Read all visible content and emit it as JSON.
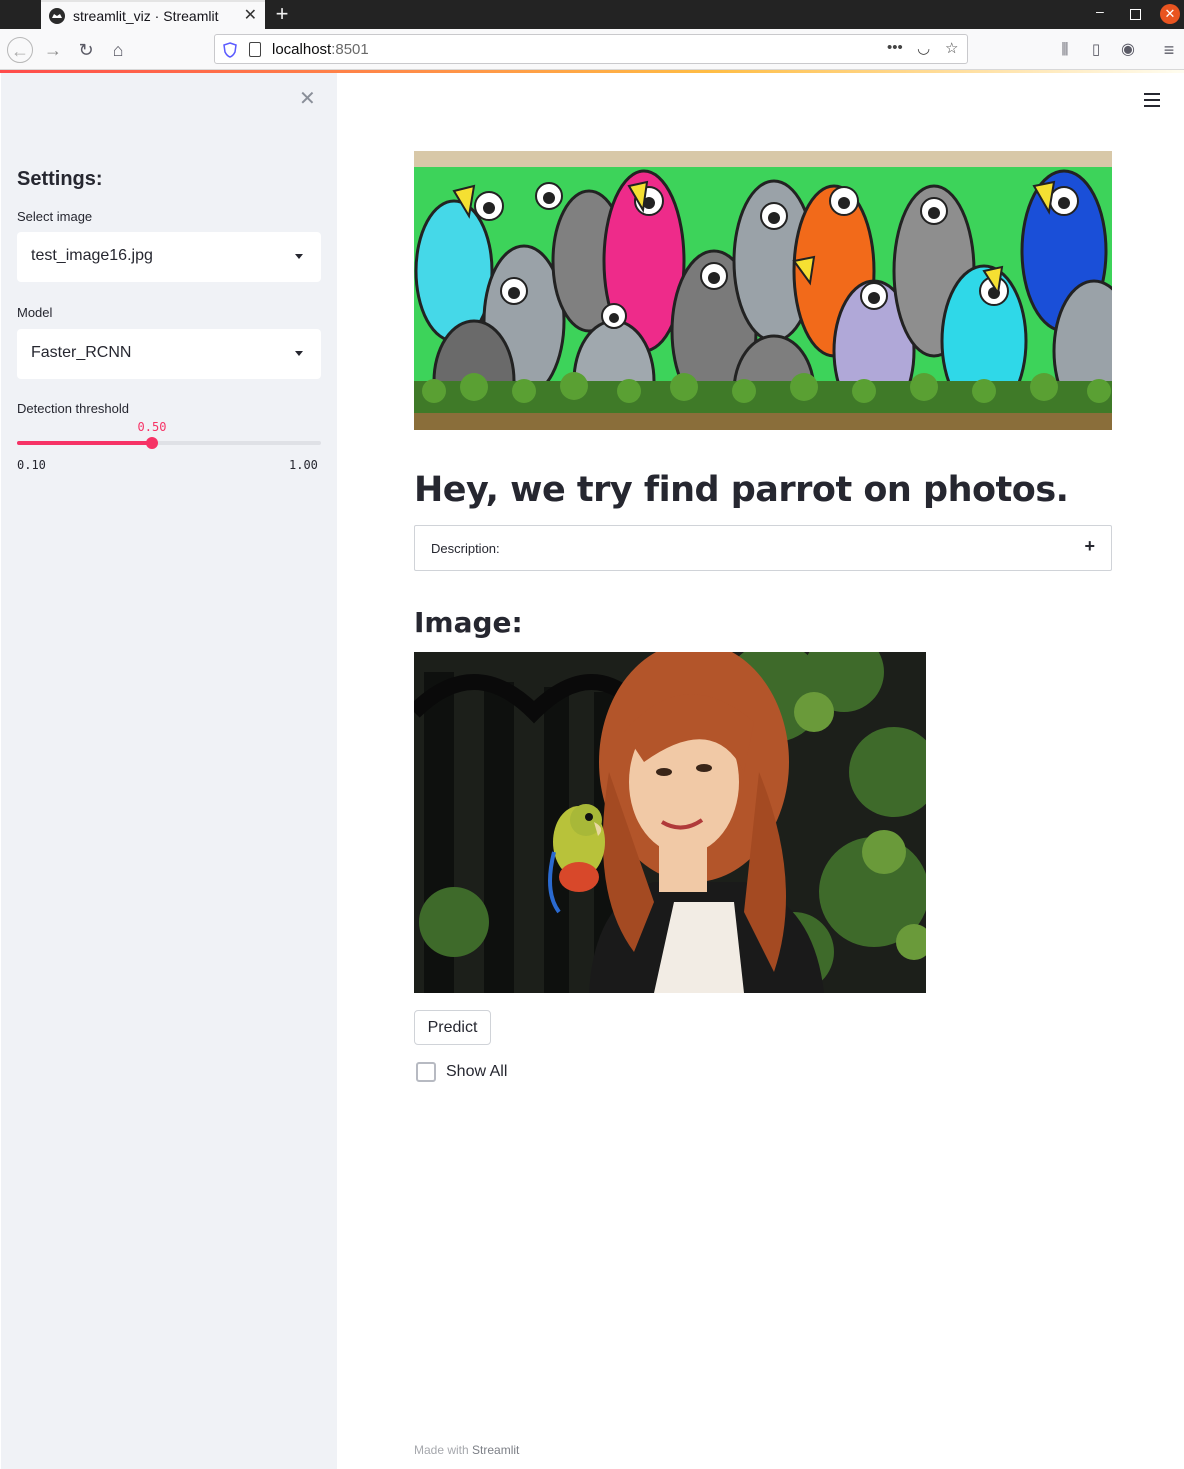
{
  "browser": {
    "tab_title": "streamlit_viz · Streamlit",
    "url_host": "localhost",
    "url_port": ":8501"
  },
  "sidebar": {
    "heading": "Settings:",
    "select_image": {
      "label": "Select image",
      "value": "test_image16.jpg"
    },
    "model": {
      "label": "Model",
      "value": "Faster_RCNN"
    },
    "threshold": {
      "label": "Detection threshold",
      "value": "0.50",
      "min": "0.10",
      "max": "1.00",
      "fraction": 0.444
    }
  },
  "main": {
    "title": "Hey, we try find parrot on photos.",
    "expander_label": "Description:",
    "image_heading": "Image:",
    "predict_label": "Predict",
    "show_all_label": "Show All",
    "footer_prefix": "Made with ",
    "footer_brand": "Streamlit"
  },
  "colors": {
    "accent": "#f63366",
    "sidebar_bg": "#f0f2f6",
    "text": "#262730"
  }
}
